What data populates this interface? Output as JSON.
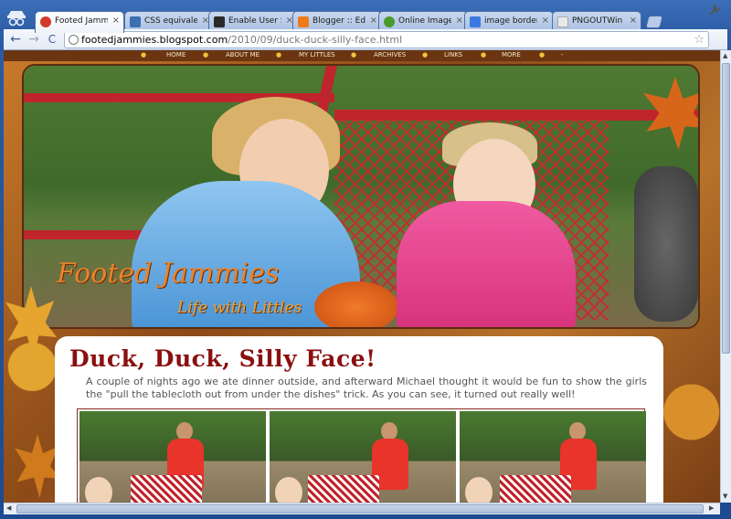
{
  "browser": {
    "tabs": [
      {
        "title": "Footed Jammi...",
        "favicon_color": "#d33a2a",
        "active": true
      },
      {
        "title": "CSS equivalent...",
        "favicon_color": "#3a6fb0",
        "active": false
      },
      {
        "title": "Enable User Scr...",
        "favicon_color": "#2a2a2a",
        "active": false
      },
      {
        "title": "Blogger :: Edit ...",
        "favicon_color": "#f07a1a",
        "active": false
      },
      {
        "title": "Online Image ...",
        "favicon_color": "#4a9a2a",
        "active": false
      },
      {
        "title": "image border -...",
        "favicon_color": "#3a7ae0",
        "active": false
      },
      {
        "title": "PNGOUTWin - ...",
        "favicon_color": "#c8c8c8",
        "active": false
      }
    ],
    "close_glyph": "×",
    "address": {
      "host": "footedjammies.blogspot.com",
      "path": "/2010/09/duck-duck-silly-face.html"
    },
    "nav": {
      "back": "←",
      "forward": "→",
      "reload": "C"
    },
    "star": "☆",
    "wrench": "🔧"
  },
  "blog": {
    "nav_items": [
      "HOME",
      "ABOUT ME",
      "MY LITTLES",
      "ARCHIVES",
      "LINKS",
      "MORE",
      "-"
    ],
    "nav_separator": "●",
    "title": "Footed Jammies",
    "subtitle": "Life with Littles"
  },
  "post": {
    "title": "Duck, Duck, Silly Face!",
    "body": "A couple of nights ago we ate dinner outside, and afterward Michael thought it would be fun to show the girls the \"pull the tablecloth out from under the dishes\" trick. As you can see, it turned out really well!"
  },
  "colors": {
    "accent_title": "#8a1010",
    "blog_title": "#e8832a",
    "chrome_blue": "#2a5ba4"
  }
}
